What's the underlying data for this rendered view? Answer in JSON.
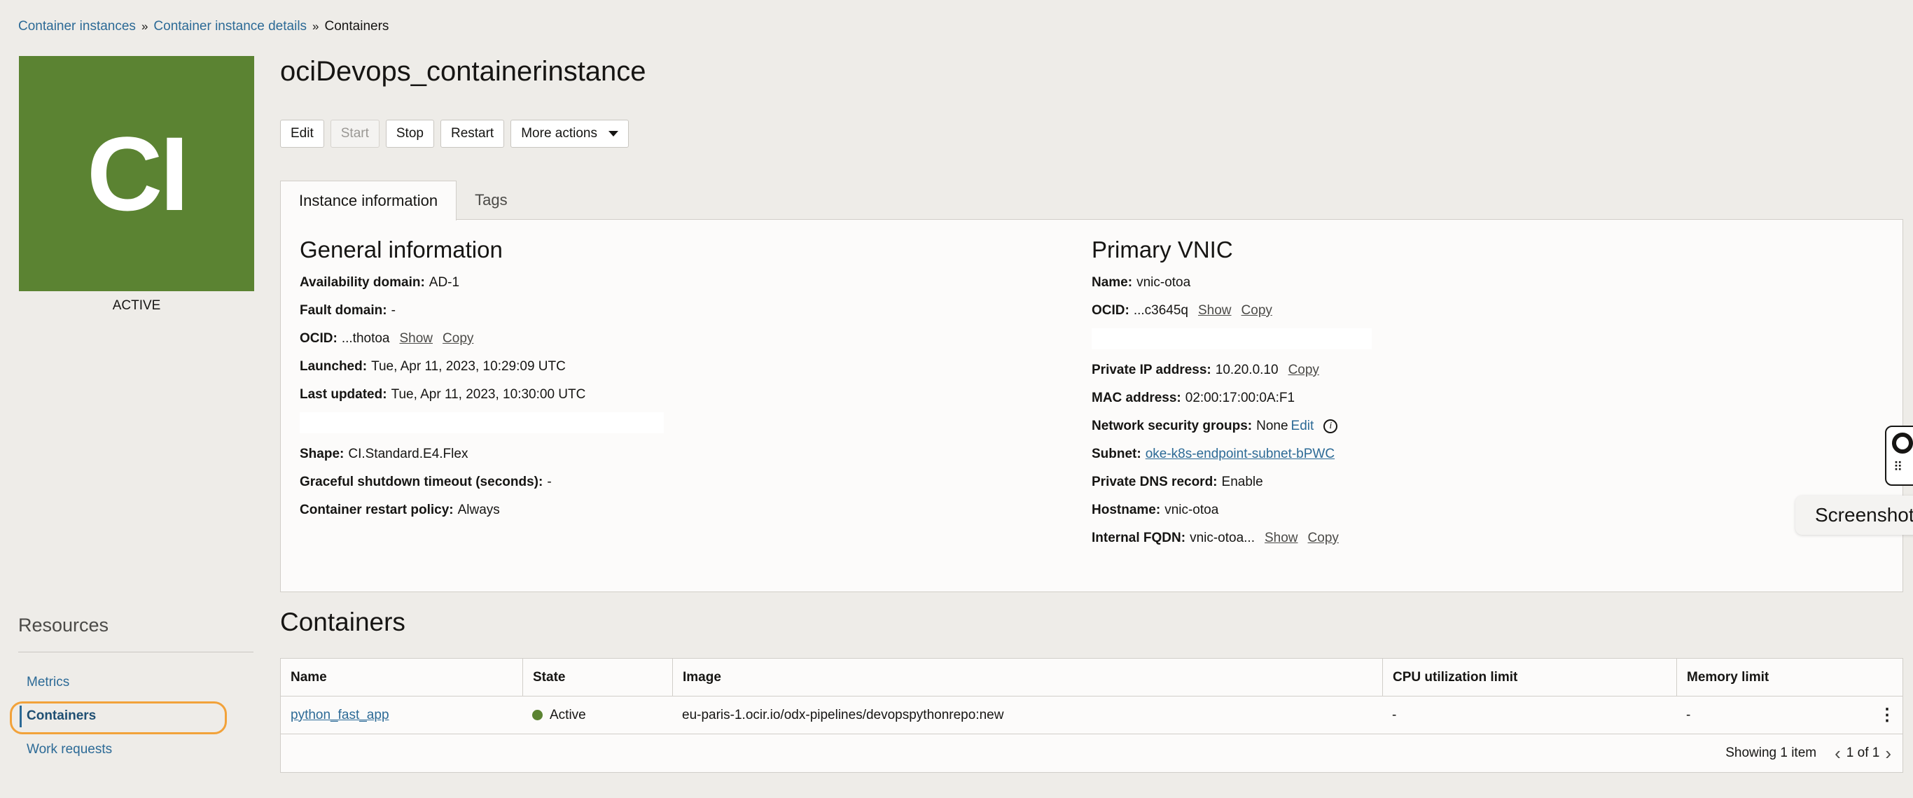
{
  "breadcrumb": {
    "items": [
      "Container instances",
      "Container instance details"
    ],
    "current": "Containers",
    "separator": "»"
  },
  "avatar": {
    "initials": "CI",
    "status": "ACTIVE",
    "color": "#5b8332"
  },
  "title": "ociDevops_containerinstance",
  "actions": {
    "edit": "Edit",
    "start": "Start",
    "stop": "Stop",
    "restart": "Restart",
    "more": "More actions"
  },
  "tabs": [
    "Instance information",
    "Tags"
  ],
  "general": {
    "title": "General information",
    "availability_domain": {
      "label": "Availability domain:",
      "value": "AD-1"
    },
    "fault_domain": {
      "label": "Fault domain:",
      "value": "-"
    },
    "ocid": {
      "label": "OCID:",
      "value": "...thotoa",
      "show": "Show",
      "copy": "Copy"
    },
    "launched": {
      "label": "Launched:",
      "value": "Tue, Apr 11, 2023, 10:29:09 UTC"
    },
    "last_updated": {
      "label": "Last updated:",
      "value": "Tue, Apr 11, 2023, 10:30:00 UTC"
    },
    "shape": {
      "label": "Shape:",
      "value": "CI.Standard.E4.Flex"
    },
    "graceful_shutdown": {
      "label": "Graceful shutdown timeout (seconds):",
      "value": "-"
    },
    "restart_policy": {
      "label": "Container restart policy:",
      "value": "Always"
    }
  },
  "vnic": {
    "title": "Primary VNIC",
    "name": {
      "label": "Name:",
      "value": "vnic-otoa"
    },
    "ocid": {
      "label": "OCID:",
      "value": "...c3645q",
      "show": "Show",
      "copy": "Copy"
    },
    "private_ip": {
      "label": "Private IP address:",
      "value": "10.20.0.10",
      "copy": "Copy"
    },
    "mac": {
      "label": "MAC address:",
      "value": "02:00:17:00:0A:F1"
    },
    "nsg": {
      "label": "Network security groups:",
      "value": "None",
      "edit": "Edit"
    },
    "subnet": {
      "label": "Subnet:",
      "value": "oke-k8s-endpoint-subnet-bPWC"
    },
    "private_dns": {
      "label": "Private DNS record:",
      "value": "Enable"
    },
    "hostname": {
      "label": "Hostname:",
      "value": "vnic-otoa"
    },
    "fqdn": {
      "label": "Internal FQDN:",
      "value": "vnic-otoa...",
      "show": "Show",
      "copy": "Copy"
    }
  },
  "resources": {
    "title": "Resources",
    "items": [
      "Metrics",
      "Containers",
      "Work requests"
    ]
  },
  "containers": {
    "title": "Containers",
    "columns": [
      "Name",
      "State",
      "Image",
      "CPU utilization limit",
      "Memory limit"
    ],
    "rows": [
      {
        "name": "python_fast_app",
        "state": "Active",
        "image": "eu-paris-1.ocir.io/odx-pipelines/devopspythonrepo:new",
        "cpu": "-",
        "memory": "-"
      }
    ],
    "showing": "Showing 1 item",
    "page": "1 of 1"
  },
  "overlay": {
    "screenshot_label": "Screenshot"
  }
}
